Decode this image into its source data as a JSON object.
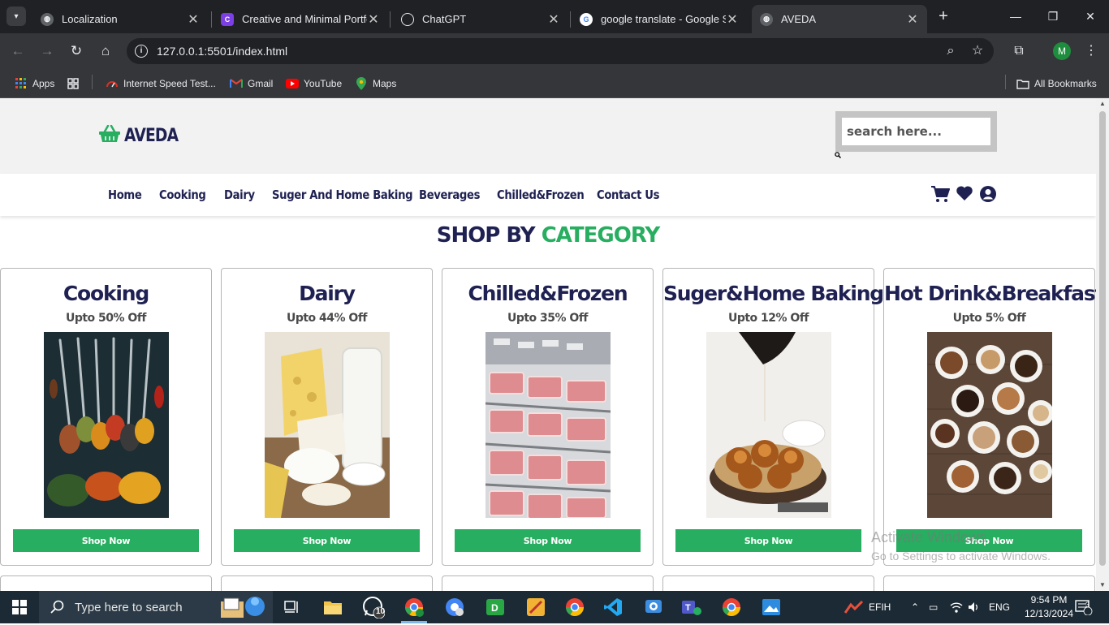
{
  "browser": {
    "tabs": [
      {
        "title": "Localization",
        "close": "✕"
      },
      {
        "title": "Creative and Minimal Portfoli",
        "close": "✕"
      },
      {
        "title": "ChatGPT",
        "close": "✕"
      },
      {
        "title": "google translate - Google Se",
        "close": "✕"
      },
      {
        "title": "AVEDA",
        "close": "✕"
      }
    ],
    "url": "127.0.0.1:5501/index.html",
    "profile_initial": "M",
    "bookmarks": [
      {
        "label": "Apps",
        "icon": "apps-grid-icon"
      },
      {
        "label": "",
        "icon": "grid-icon"
      },
      {
        "label": "Internet Speed Test...",
        "icon": "speedometer-icon"
      },
      {
        "label": "Gmail",
        "icon": "gmail-icon"
      },
      {
        "label": "YouTube",
        "icon": "youtube-icon"
      },
      {
        "label": "Maps",
        "icon": "maps-icon"
      }
    ],
    "all_bookmarks": "All Bookmarks"
  },
  "site": {
    "logo_text": "AVEDA",
    "search_placeholder": "search here...",
    "nav": [
      "Home",
      "Cooking",
      "Dairy",
      "Suger And Home Baking",
      "Beverages",
      "Chilled&Frozen",
      "Contact Us"
    ],
    "section_title_part1": "SHOP BY",
    "section_title_part2": "CATEGORY",
    "cards": [
      {
        "title": "Cooking",
        "offer": "Upto 50% Off",
        "button": "Shop Now",
        "image": "spices-image"
      },
      {
        "title": "Dairy",
        "offer": "Upto 44% Off",
        "button": "Shop Now",
        "image": "dairy-image"
      },
      {
        "title": "Chilled&Frozen",
        "offer": "Upto 35% Off",
        "button": "Shop Now",
        "image": "meat-fridge-image"
      },
      {
        "title": "Suger&Home Baking",
        "offer": "Upto 12% Off",
        "button": "Shop Now",
        "image": "baked-buns-image"
      },
      {
        "title": "Hot Drink&Breakfast",
        "offer": "Upto 5% Off",
        "button": "Shop Now",
        "image": "coffee-cups-image"
      }
    ],
    "colors": {
      "navy": "#1f2152",
      "green": "#27ae60"
    }
  },
  "watermark": {
    "line1": "Activate Windows",
    "line2": "Go to Settings to activate Windows."
  },
  "taskbar": {
    "search_placeholder": "Type here to search",
    "whatsapp_badge": "10",
    "weather": "EFIH",
    "language": "ENG",
    "time": "9:54 PM",
    "date": "12/13/2024",
    "notifications": "3"
  }
}
